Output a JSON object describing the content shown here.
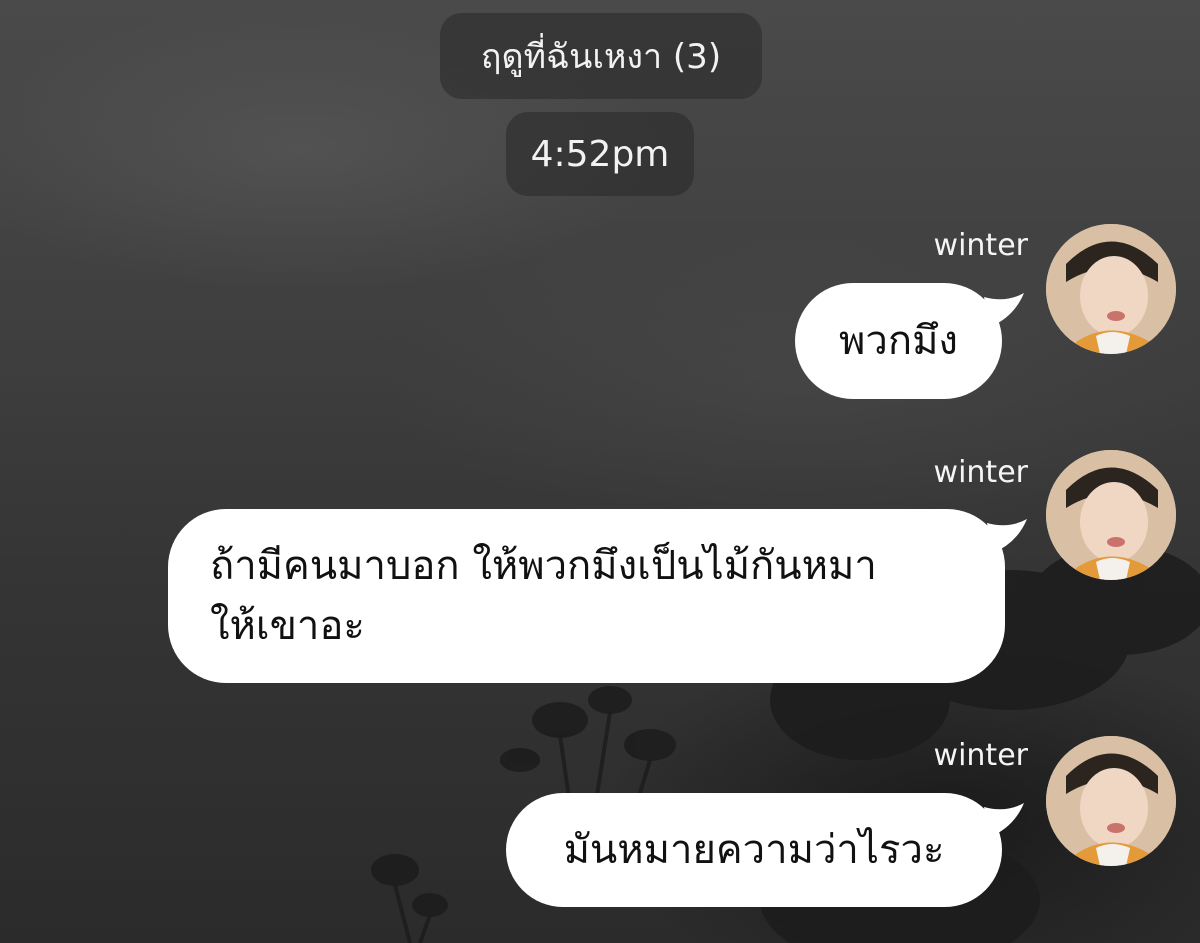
{
  "header": {
    "chat_title": "ฤดูที่ฉันเหงา (3)",
    "time": "4:52pm"
  },
  "messages": [
    {
      "sender": "winter",
      "text": "พวกมึง"
    },
    {
      "sender": "winter",
      "text_lines": [
        "ถ้ามีคนมาบอก ให้พวกมึงเป็นไม้กันหมา",
        "ให้เขาอะ"
      ]
    },
    {
      "sender": "winter",
      "text": "มันหมายความว่าไรวะ"
    }
  ],
  "colors": {
    "bubble": "#ffffff",
    "background": "#3c3c3c",
    "pill": "rgba(40,40,40,0.55)"
  }
}
